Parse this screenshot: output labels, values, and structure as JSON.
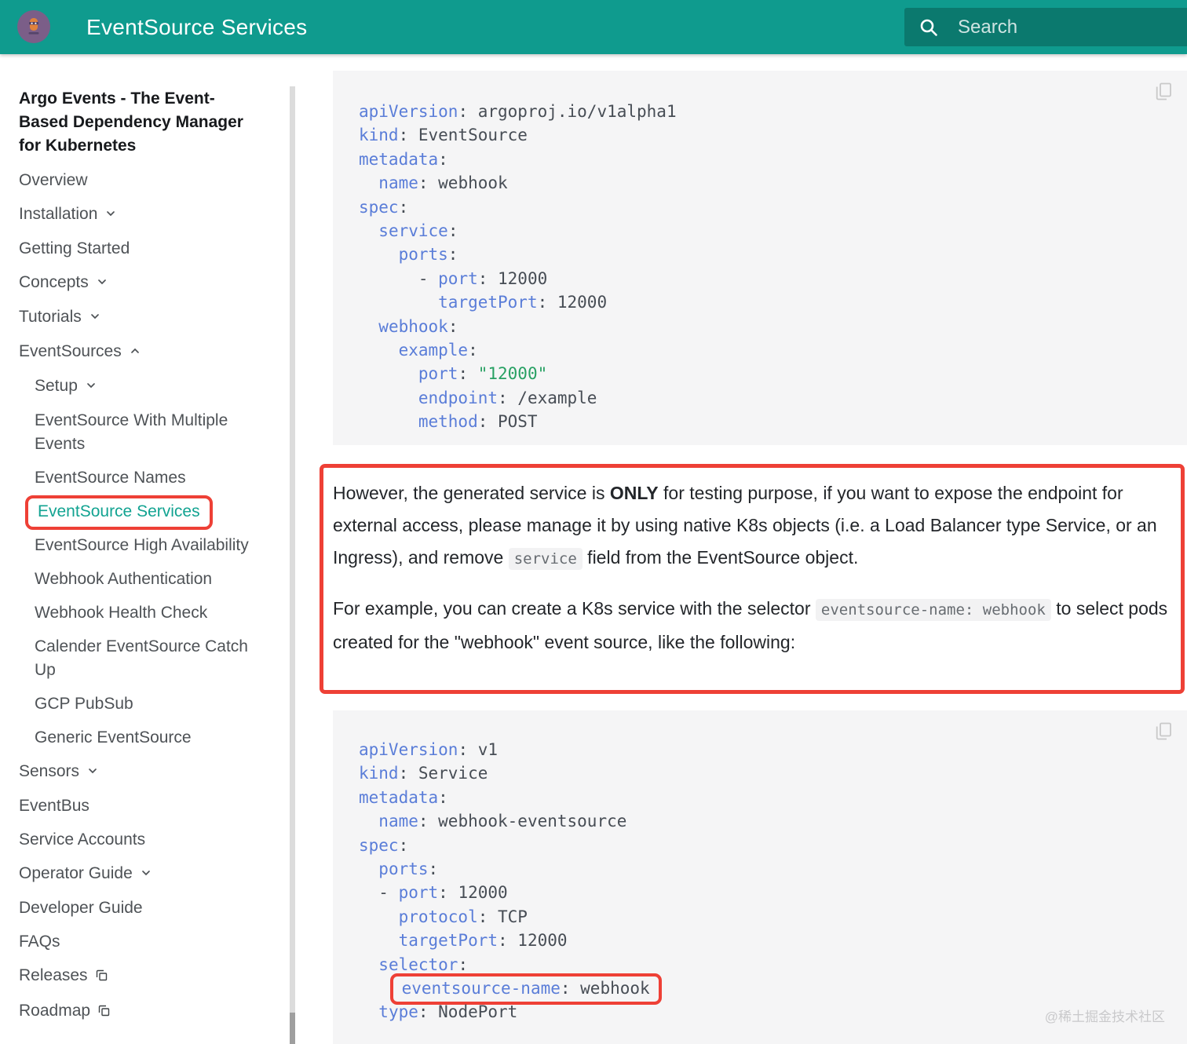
{
  "header": {
    "title": "EventSource Services",
    "search_placeholder": "Search"
  },
  "colors": {
    "primary_teal": "#0f9b8e",
    "active_link_teal": "#12a391",
    "annotation_red": "#ee4036",
    "code_key_blue": "#5a7dd8",
    "code_string_green": "#27a063",
    "code_background": "#f5f5f6"
  },
  "sidebar": {
    "title": "Argo Events - The Event-Based Dependency Manager for Kubernetes",
    "items": [
      {
        "label": "Overview",
        "level": 0
      },
      {
        "label": "Installation",
        "level": 0,
        "caret": "down"
      },
      {
        "label": "Getting Started",
        "level": 0
      },
      {
        "label": "Concepts",
        "level": 0,
        "caret": "down"
      },
      {
        "label": "Tutorials",
        "level": 0,
        "caret": "down"
      },
      {
        "label": "EventSources",
        "level": 0,
        "caret": "up"
      },
      {
        "label": "Setup",
        "level": 1,
        "caret": "down"
      },
      {
        "label": "EventSource With Multiple Events",
        "level": 1
      },
      {
        "label": "EventSource Names",
        "level": 1
      },
      {
        "label": "EventSource Services",
        "level": 1,
        "active": true,
        "annotated": true
      },
      {
        "label": "EventSource High Availability",
        "level": 1
      },
      {
        "label": "Webhook Authentication",
        "level": 1
      },
      {
        "label": "Webhook Health Check",
        "level": 1
      },
      {
        "label": "Calender EventSource Catch Up",
        "level": 1
      },
      {
        "label": "GCP PubSub",
        "level": 1
      },
      {
        "label": "Generic EventSource",
        "level": 1
      },
      {
        "label": "Sensors",
        "level": 0,
        "caret": "down"
      },
      {
        "label": "EventBus",
        "level": 0
      },
      {
        "label": "Service Accounts",
        "level": 0
      },
      {
        "label": "Operator Guide",
        "level": 0,
        "caret": "down"
      },
      {
        "label": "Developer Guide",
        "level": 0
      },
      {
        "label": "FAQs",
        "level": 0
      },
      {
        "label": "Releases",
        "level": 0,
        "external": true
      },
      {
        "label": "Roadmap",
        "level": 0,
        "external": true
      }
    ]
  },
  "main": {
    "code_blocks": [
      {
        "name": "code-block-1",
        "language": "yaml",
        "lines": [
          {
            "pre": "",
            "tokens": [
              [
                "key",
                "apiVersion"
              ],
              [
                "plain",
                ": argoproj.io/v1alpha1"
              ]
            ]
          },
          {
            "pre": "",
            "tokens": [
              [
                "key",
                "kind"
              ],
              [
                "plain",
                ": EventSource"
              ]
            ]
          },
          {
            "pre": "",
            "tokens": [
              [
                "key",
                "metadata"
              ],
              [
                "plain",
                ":"
              ]
            ]
          },
          {
            "pre": "  ",
            "tokens": [
              [
                "key",
                "name"
              ],
              [
                "plain",
                ": webhook"
              ]
            ]
          },
          {
            "pre": "",
            "tokens": [
              [
                "key",
                "spec"
              ],
              [
                "plain",
                ":"
              ]
            ]
          },
          {
            "pre": "  ",
            "tokens": [
              [
                "key",
                "service"
              ],
              [
                "plain",
                ":"
              ]
            ]
          },
          {
            "pre": "    ",
            "tokens": [
              [
                "key",
                "ports"
              ],
              [
                "plain",
                ":"
              ]
            ]
          },
          {
            "pre": "      - ",
            "tokens": [
              [
                "key",
                "port"
              ],
              [
                "plain",
                ": 12000"
              ]
            ]
          },
          {
            "pre": "        ",
            "tokens": [
              [
                "key",
                "targetPort"
              ],
              [
                "plain",
                ": 12000"
              ]
            ]
          },
          {
            "pre": "  ",
            "tokens": [
              [
                "key",
                "webhook"
              ],
              [
                "plain",
                ":"
              ]
            ]
          },
          {
            "pre": "    ",
            "tokens": [
              [
                "key",
                "example"
              ],
              [
                "plain",
                ":"
              ]
            ]
          },
          {
            "pre": "      ",
            "tokens": [
              [
                "key",
                "port"
              ],
              [
                "plain",
                ": "
              ],
              [
                "string",
                "\"12000\""
              ]
            ]
          },
          {
            "pre": "      ",
            "tokens": [
              [
                "key",
                "endpoint"
              ],
              [
                "plain",
                ": /example"
              ]
            ]
          },
          {
            "pre": "      ",
            "tokens": [
              [
                "key",
                "method"
              ],
              [
                "plain",
                ": POST"
              ]
            ]
          }
        ]
      },
      {
        "name": "code-block-2",
        "language": "yaml",
        "lines": [
          {
            "pre": "",
            "tokens": [
              [
                "key",
                "apiVersion"
              ],
              [
                "plain",
                ": v1"
              ]
            ]
          },
          {
            "pre": "",
            "tokens": [
              [
                "key",
                "kind"
              ],
              [
                "plain",
                ": Service"
              ]
            ]
          },
          {
            "pre": "",
            "tokens": [
              [
                "key",
                "metadata"
              ],
              [
                "plain",
                ":"
              ]
            ]
          },
          {
            "pre": "  ",
            "tokens": [
              [
                "key",
                "name"
              ],
              [
                "plain",
                ": webhook-eventsource"
              ]
            ]
          },
          {
            "pre": "",
            "tokens": [
              [
                "key",
                "spec"
              ],
              [
                "plain",
                ":"
              ]
            ]
          },
          {
            "pre": "  ",
            "tokens": [
              [
                "key",
                "ports"
              ],
              [
                "plain",
                ":"
              ]
            ]
          },
          {
            "pre": "  - ",
            "tokens": [
              [
                "key",
                "port"
              ],
              [
                "plain",
                ": 12000"
              ]
            ]
          },
          {
            "pre": "    ",
            "tokens": [
              [
                "key",
                "protocol"
              ],
              [
                "plain",
                ": TCP"
              ]
            ]
          },
          {
            "pre": "    ",
            "tokens": [
              [
                "key",
                "targetPort"
              ],
              [
                "plain",
                ": 12000"
              ]
            ]
          },
          {
            "pre": "  ",
            "tokens": [
              [
                "key",
                "selector"
              ],
              [
                "plain",
                ":"
              ]
            ]
          },
          {
            "pre": "    ",
            "boxed": true,
            "tokens": [
              [
                "key",
                "eventsource-name"
              ],
              [
                "plain",
                ": webhook"
              ]
            ]
          },
          {
            "pre": "  ",
            "tokens": [
              [
                "key",
                "type"
              ],
              [
                "plain",
                ": NodePort"
              ]
            ]
          }
        ]
      }
    ],
    "note": {
      "paragraphs": [
        [
          [
            "text",
            "However, the generated service is "
          ],
          [
            "bold",
            "ONLY"
          ],
          [
            "text",
            " for testing purpose, if you want to expose the endpoint for external access, please manage it by using native K8s objects (i.e. a Load Balancer type Service, or an Ingress), and remove "
          ],
          [
            "code",
            "service"
          ],
          [
            "text",
            " field from the EventSource object."
          ]
        ],
        [
          [
            "text",
            "For example, you can create a K8s service with the selector "
          ],
          [
            "code",
            "eventsource-name: webhook"
          ],
          [
            "text",
            " to select pods created for the \"webhook\" event source, like the following:"
          ]
        ]
      ]
    }
  },
  "watermark": "@稀土掘金技术社区"
}
